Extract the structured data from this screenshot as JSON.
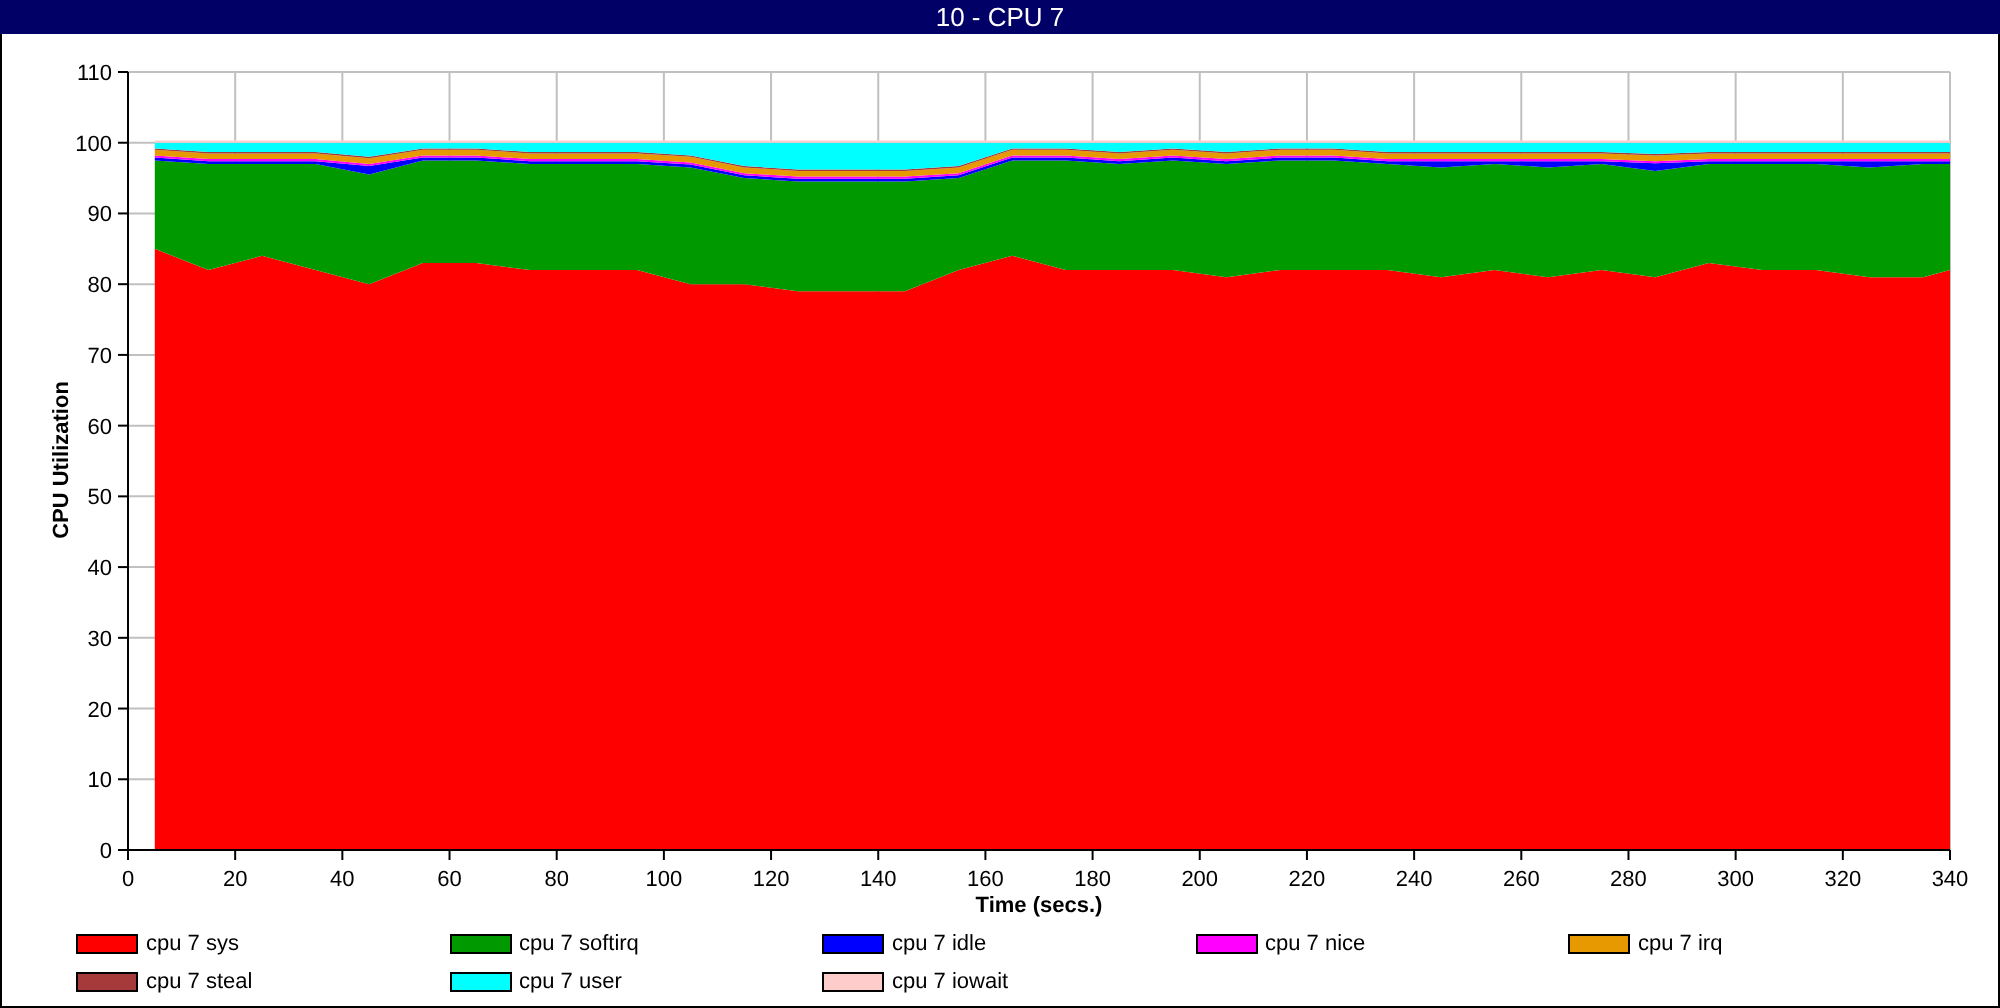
{
  "window": {
    "title": "10 - CPU 7"
  },
  "chart_data": {
    "type": "area",
    "stacked": true,
    "grid": true,
    "xlabel": "Time (secs.)",
    "ylabel": "CPU Utilization",
    "xlim": [
      0,
      340
    ],
    "ylim": [
      0,
      110
    ],
    "xticks": [
      0,
      20,
      40,
      60,
      80,
      100,
      120,
      140,
      160,
      180,
      200,
      220,
      240,
      260,
      280,
      300,
      320,
      340
    ],
    "yticks": [
      0,
      10,
      20,
      30,
      40,
      50,
      60,
      70,
      80,
      90,
      100,
      110
    ],
    "x": [
      5,
      15,
      25,
      35,
      45,
      55,
      65,
      75,
      85,
      95,
      105,
      115,
      125,
      135,
      145,
      155,
      165,
      175,
      185,
      195,
      205,
      215,
      225,
      235,
      245,
      255,
      265,
      275,
      285,
      295,
      305,
      315,
      325,
      335,
      340
    ],
    "series": [
      {
        "name": "cpu 7 sys",
        "color": "#ff0000",
        "values": [
          85,
          82,
          84,
          82,
          80,
          83,
          83,
          82,
          82,
          82,
          80,
          80,
          79,
          79,
          79,
          82,
          84,
          82,
          82,
          82,
          81,
          82,
          82,
          82,
          81,
          82,
          81,
          82,
          81,
          83,
          82,
          82,
          81,
          81,
          82
        ]
      },
      {
        "name": "cpu 7 softirq",
        "color": "#009900",
        "values": [
          12.5,
          15,
          13,
          15,
          15.5,
          14.5,
          14.5,
          15,
          15,
          15,
          16.5,
          15,
          15.5,
          15.5,
          15.5,
          13,
          13.5,
          15.5,
          15,
          15.5,
          16,
          15.5,
          15.5,
          15,
          15.5,
          15,
          15.5,
          15,
          15,
          14,
          15,
          15,
          15.5,
          16,
          15
        ]
      },
      {
        "name": "cpu 7 idle",
        "color": "#0000ff",
        "values": [
          0.4,
          0.4,
          0.4,
          0.4,
          1.2,
          0.4,
          0.4,
          0.4,
          0.4,
          0.4,
          0.4,
          0.4,
          0.4,
          0.4,
          0.4,
          0.4,
          0.4,
          0.4,
          0.4,
          0.4,
          0.4,
          0.4,
          0.4,
          0.4,
          0.9,
          0.4,
          0.9,
          0.4,
          1.1,
          0.4,
          0.4,
          0.4,
          0.9,
          0.4,
          0.4
        ]
      },
      {
        "name": "cpu 7 nice",
        "color": "#ff00ff",
        "values": [
          0.3,
          0.3,
          0.3,
          0.3,
          0.3,
          0.3,
          0.3,
          0.3,
          0.3,
          0.3,
          0.3,
          0.3,
          0.3,
          0.3,
          0.3,
          0.3,
          0.3,
          0.3,
          0.3,
          0.3,
          0.3,
          0.3,
          0.3,
          0.3,
          0.3,
          0.3,
          0.3,
          0.3,
          0.3,
          0.3,
          0.3,
          0.3,
          0.3,
          0.3,
          0.3
        ]
      },
      {
        "name": "cpu 7 irq",
        "color": "#e69900",
        "values": [
          0.8,
          0.8,
          0.8,
          0.8,
          0.8,
          0.8,
          0.8,
          0.8,
          0.8,
          0.8,
          0.8,
          0.8,
          0.8,
          0.8,
          0.8,
          0.8,
          0.8,
          0.8,
          0.8,
          0.8,
          0.8,
          0.8,
          0.8,
          0.8,
          0.8,
          0.8,
          0.8,
          0.8,
          0.8,
          0.8,
          0.8,
          0.8,
          0.8,
          0.8,
          0.8
        ]
      },
      {
        "name": "cpu 7 steal",
        "color": "#a63a3a",
        "values": [
          0.2,
          0.2,
          0.2,
          0.2,
          0.2,
          0.2,
          0.2,
          0.2,
          0.2,
          0.2,
          0.2,
          0.2,
          0.2,
          0.2,
          0.2,
          0.2,
          0.2,
          0.2,
          0.2,
          0.2,
          0.2,
          0.2,
          0.2,
          0.2,
          0.2,
          0.2,
          0.2,
          0.2,
          0.2,
          0.2,
          0.2,
          0.2,
          0.2,
          0.2,
          0.2
        ]
      },
      {
        "name": "cpu 7 user",
        "color": "#00ffff",
        "values": [
          0.8,
          1.3,
          1.3,
          1.3,
          2.0,
          0.8,
          0.8,
          1.3,
          1.3,
          1.3,
          1.8,
          3.3,
          3.8,
          3.8,
          3.8,
          3.3,
          0.8,
          0.8,
          1.3,
          0.8,
          1.3,
          0.8,
          0.8,
          1.3,
          1.3,
          1.3,
          1.3,
          1.3,
          1.6,
          1.3,
          1.3,
          1.3,
          1.3,
          1.3,
          1.3
        ]
      },
      {
        "name": "cpu 7 iowait",
        "color": "#ffcccc",
        "values": [
          0.3,
          0.3,
          0.3,
          0.3,
          0.3,
          0.3,
          0.3,
          0.3,
          0.3,
          0.3,
          0.3,
          0.3,
          0.3,
          0.3,
          0.3,
          0.3,
          0.3,
          0.3,
          0.3,
          0.3,
          0.3,
          0.3,
          0.3,
          0.3,
          0.3,
          0.3,
          0.3,
          0.3,
          0.3,
          0.3,
          0.3,
          0.3,
          0.3,
          0.3,
          0.3
        ]
      }
    ]
  }
}
